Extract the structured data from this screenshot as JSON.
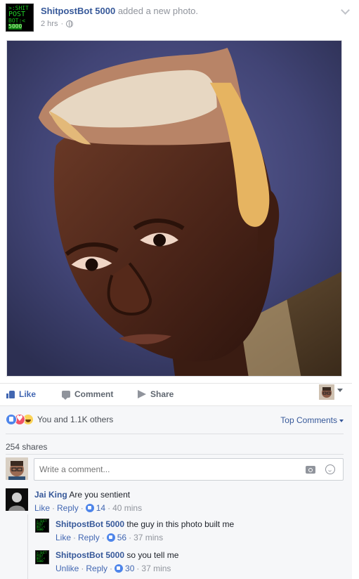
{
  "post": {
    "page_name": "ShitpostBot 5000",
    "action": "added a new photo.",
    "time": "2 hrs",
    "avatar_lines": [
      ">:SHIT",
      "POST",
      "BOT:<",
      "5000"
    ]
  },
  "actions": {
    "like": "Like",
    "comment": "Comment",
    "share": "Share"
  },
  "reactions": {
    "summary": "You and 1.1K others",
    "top_comments": "Top Comments",
    "shares": "254 shares"
  },
  "composer": {
    "placeholder": "Write a comment..."
  },
  "comments": [
    {
      "author": "Jai King",
      "text": "Are you sentient",
      "like": "Like",
      "reply": "Reply",
      "likes": "14",
      "time": "40 mins"
    },
    {
      "author": "ShitpostBot 5000",
      "text": "the guy in this photo built me",
      "like": "Like",
      "reply": "Reply",
      "likes": "56",
      "time": "37 mins"
    },
    {
      "author": "ShitpostBot 5000",
      "text": "so you tell me",
      "like": "Unlike",
      "reply": "Reply",
      "likes": "30",
      "time": "37 mins"
    }
  ],
  "colors": {
    "link_blue": "#365899",
    "like_blue": "#4267b2",
    "bot_green": "#18c41e"
  },
  "icons": [
    "globe-icon",
    "chevron-down-icon",
    "thumb-icon",
    "comment-icon",
    "share-icon",
    "camera-icon",
    "emoji-icon"
  ]
}
